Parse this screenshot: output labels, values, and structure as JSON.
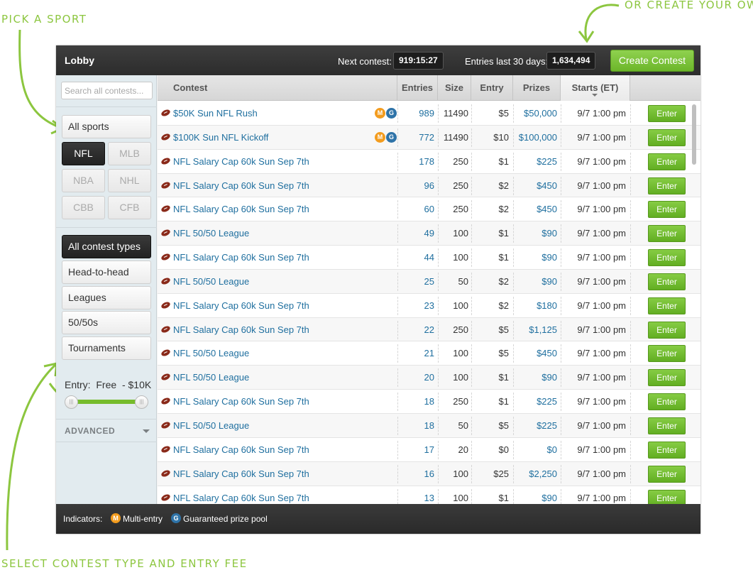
{
  "annotations": {
    "pick_sport": "PICK A SPORT",
    "create_own": "OR CREATE YOUR OWN",
    "select_type": "SELECT CONTEST TYPE AND ENTRY FEE",
    "color": "#8cc63f"
  },
  "header": {
    "title": "Lobby",
    "next_contest_label": "Next contest:",
    "next_contest_value": "919:15:27",
    "entries_label": "Entries last 30 days:",
    "entries_value": "1,634,494",
    "create_button": "Create Contest"
  },
  "sidebar": {
    "search_placeholder": "Search all contests...",
    "all_sports": "All sports",
    "sports": [
      {
        "label": "NFL",
        "state": "active"
      },
      {
        "label": "MLB",
        "state": "disabled"
      },
      {
        "label": "NBA",
        "state": "disabled"
      },
      {
        "label": "NHL",
        "state": "disabled"
      },
      {
        "label": "CBB",
        "state": "disabled"
      },
      {
        "label": "CFB",
        "state": "disabled"
      }
    ],
    "contest_types": [
      {
        "label": "All contest types",
        "active": true
      },
      {
        "label": "Head-to-head",
        "active": false
      },
      {
        "label": "Leagues",
        "active": false
      },
      {
        "label": "50/50s",
        "active": false
      },
      {
        "label": "Tournaments",
        "active": false
      }
    ],
    "entry_filter": {
      "label": "Entry:",
      "min": "Free",
      "separator": "-",
      "max": "$10K",
      "range_fraction": [
        0,
        1
      ]
    },
    "advanced": "ADVANCED"
  },
  "table": {
    "columns": [
      "Contest",
      "Entries",
      "Size",
      "Entry",
      "Prizes",
      "Starts (ET)"
    ],
    "sorted_column": "Starts (ET)",
    "sport_icon": "football-icon",
    "enter_label": "Enter",
    "rows": [
      {
        "name": "$50K Sun NFL Rush",
        "badges": [
          "M",
          "G"
        ],
        "entries": "989",
        "size": "11490",
        "entry": "$5",
        "prizes": "$50,000",
        "starts": "9/7 1:00 pm"
      },
      {
        "name": "$100K Sun NFL Kickoff",
        "badges": [
          "M",
          "G"
        ],
        "entries": "772",
        "size": "11490",
        "entry": "$10",
        "prizes": "$100,000",
        "starts": "9/7 1:00 pm"
      },
      {
        "name": "NFL Salary Cap 60k Sun Sep 7th",
        "badges": [],
        "entries": "178",
        "size": "250",
        "entry": "$1",
        "prizes": "$225",
        "starts": "9/7 1:00 pm"
      },
      {
        "name": "NFL Salary Cap 60k Sun Sep 7th",
        "badges": [],
        "entries": "96",
        "size": "250",
        "entry": "$2",
        "prizes": "$450",
        "starts": "9/7 1:00 pm"
      },
      {
        "name": "NFL Salary Cap 60k Sun Sep 7th",
        "badges": [],
        "entries": "60",
        "size": "250",
        "entry": "$2",
        "prizes": "$450",
        "starts": "9/7 1:00 pm"
      },
      {
        "name": "NFL 50/50 League",
        "badges": [],
        "entries": "49",
        "size": "100",
        "entry": "$1",
        "prizes": "$90",
        "starts": "9/7 1:00 pm"
      },
      {
        "name": "NFL Salary Cap 60k Sun Sep 7th",
        "badges": [],
        "entries": "44",
        "size": "100",
        "entry": "$1",
        "prizes": "$90",
        "starts": "9/7 1:00 pm"
      },
      {
        "name": "NFL 50/50 League",
        "badges": [],
        "entries": "25",
        "size": "50",
        "entry": "$2",
        "prizes": "$90",
        "starts": "9/7 1:00 pm"
      },
      {
        "name": "NFL Salary Cap 60k Sun Sep 7th",
        "badges": [],
        "entries": "23",
        "size": "100",
        "entry": "$2",
        "prizes": "$180",
        "starts": "9/7 1:00 pm"
      },
      {
        "name": "NFL Salary Cap 60k Sun Sep 7th",
        "badges": [],
        "entries": "22",
        "size": "250",
        "entry": "$5",
        "prizes": "$1,125",
        "starts": "9/7 1:00 pm"
      },
      {
        "name": "NFL 50/50 League",
        "badges": [],
        "entries": "21",
        "size": "100",
        "entry": "$5",
        "prizes": "$450",
        "starts": "9/7 1:00 pm"
      },
      {
        "name": "NFL 50/50 League",
        "badges": [],
        "entries": "20",
        "size": "100",
        "entry": "$1",
        "prizes": "$90",
        "starts": "9/7 1:00 pm"
      },
      {
        "name": "NFL Salary Cap 60k Sun Sep 7th",
        "badges": [],
        "entries": "18",
        "size": "250",
        "entry": "$1",
        "prizes": "$225",
        "starts": "9/7 1:00 pm"
      },
      {
        "name": "NFL 50/50 League",
        "badges": [],
        "entries": "18",
        "size": "50",
        "entry": "$5",
        "prizes": "$225",
        "starts": "9/7 1:00 pm"
      },
      {
        "name": "NFL Salary Cap 60k Sun Sep 7th",
        "badges": [],
        "entries": "17",
        "size": "20",
        "entry": "$0",
        "prizes": "$0",
        "starts": "9/7 1:00 pm"
      },
      {
        "name": "NFL Salary Cap 60k Sun Sep 7th",
        "badges": [],
        "entries": "16",
        "size": "100",
        "entry": "$25",
        "prizes": "$2,250",
        "starts": "9/7 1:00 pm"
      },
      {
        "name": "NFL Salary Cap 60k Sun Sep 7th",
        "badges": [],
        "entries": "13",
        "size": "100",
        "entry": "$1",
        "prizes": "$90",
        "starts": "9/7 1:00 pm"
      }
    ]
  },
  "footer": {
    "indicators_label": "Indicators:",
    "multi_badge": "M",
    "multi_label": "Multi-entry",
    "guaranteed_badge": "G",
    "guaranteed_label": "Guaranteed prize pool"
  },
  "colors": {
    "accent_green": "#6cb62a",
    "link_blue": "#1f6f9f",
    "multi_badge": "#f39c1e",
    "guaranteed_badge": "#2e73a8"
  }
}
